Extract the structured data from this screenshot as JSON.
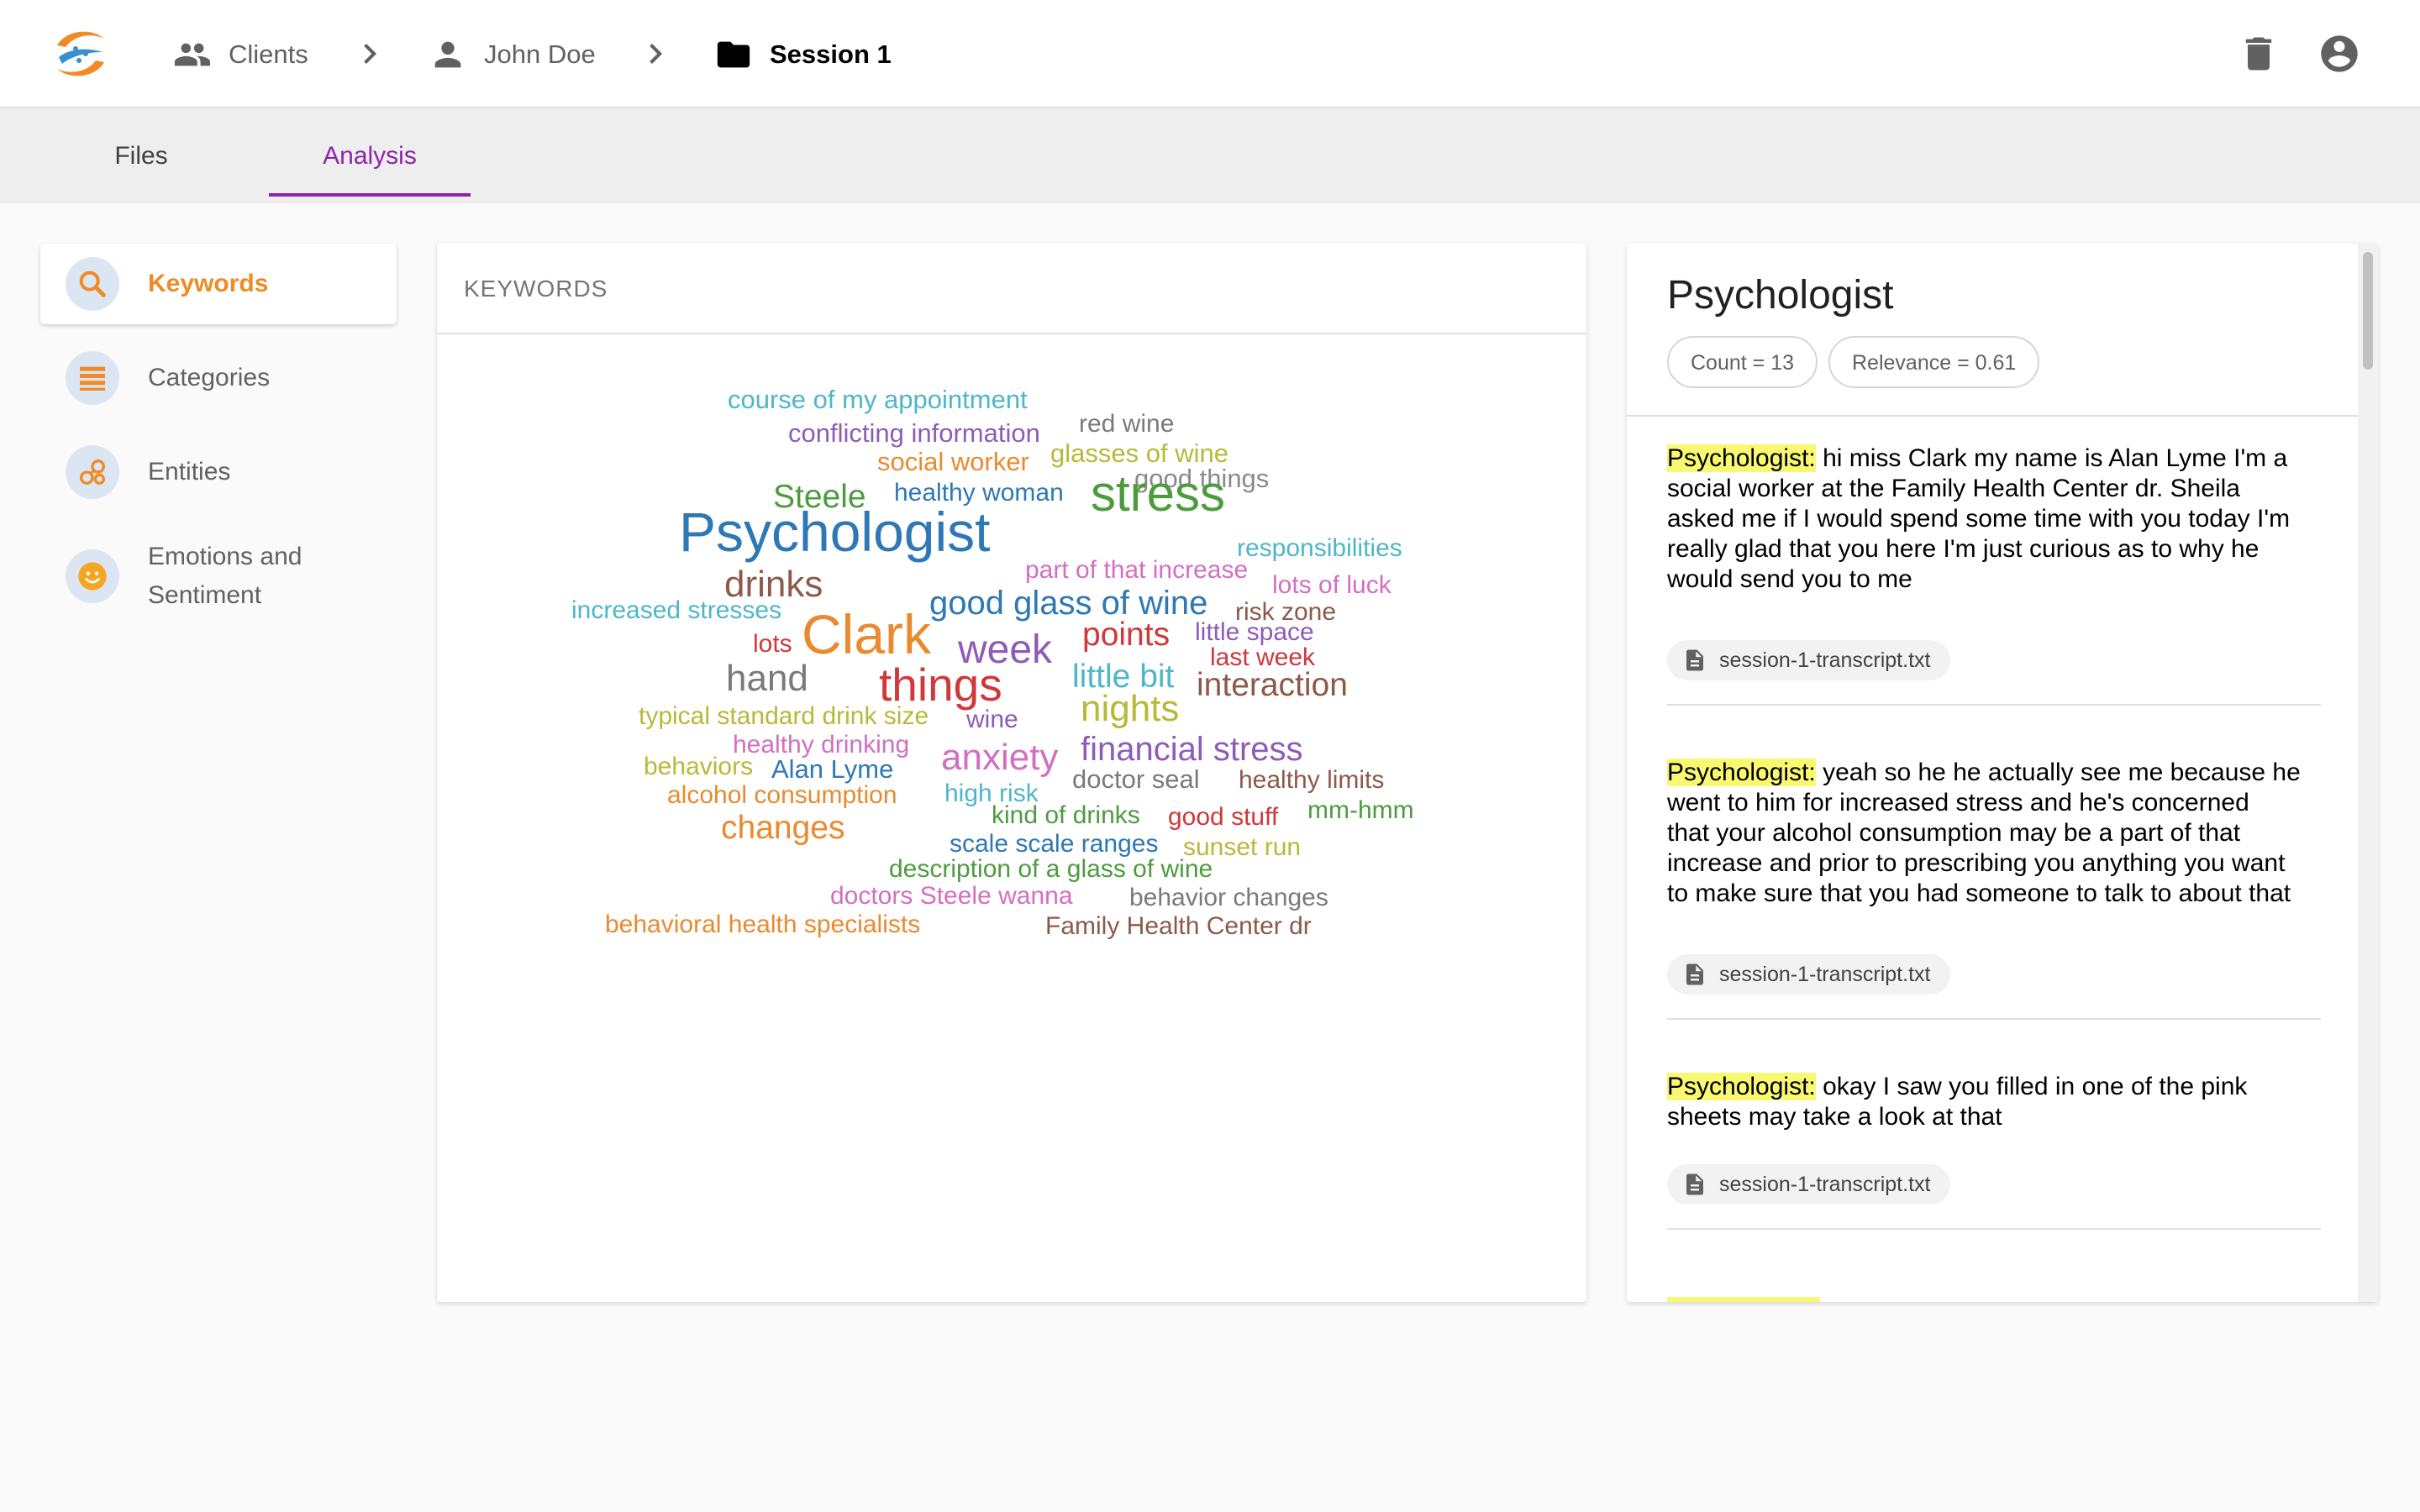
{
  "header": {
    "logo_icon": "app-logo-icon",
    "breadcrumbs": [
      {
        "label": "Clients",
        "icon": "people-icon"
      },
      {
        "label": "John Doe",
        "icon": "person-icon"
      },
      {
        "label": "Session 1",
        "icon": "folder-icon"
      }
    ],
    "actions": [
      "delete-icon",
      "account-icon"
    ]
  },
  "tabs": [
    {
      "label": "Files",
      "active": false
    },
    {
      "label": "Analysis",
      "active": true
    }
  ],
  "sidebar": {
    "items": [
      {
        "label": "Keywords",
        "icon": "search-icon",
        "active": true
      },
      {
        "label": "Categories",
        "icon": "list-icon",
        "active": false
      },
      {
        "label": "Entities",
        "icon": "entities-icon",
        "active": false
      },
      {
        "label": "Emotions and Sentiment",
        "icon": "smiley-icon",
        "active": false
      }
    ]
  },
  "keywords_panel": {
    "title": "KEYWORDS",
    "words": [
      {
        "text": "course of my appointment",
        "color": "#4fb6c8"
      },
      {
        "text": "conflicting information",
        "color": "#8e5bb5"
      },
      {
        "text": "red wine",
        "color": "#7a7a7a"
      },
      {
        "text": "social worker",
        "color": "#e98a2e"
      },
      {
        "text": "glasses of wine",
        "color": "#b8b839"
      },
      {
        "text": "good things",
        "color": "#8a8a8a"
      },
      {
        "text": "Steele",
        "color": "#4c9c3e"
      },
      {
        "text": "healthy woman",
        "color": "#2e78b5"
      },
      {
        "text": "stress",
        "color": "#4c9c3e"
      },
      {
        "text": "Psychologist",
        "color": "#2e78b5"
      },
      {
        "text": "responsibilities",
        "color": "#4fb6c8"
      },
      {
        "text": "part of that increase",
        "color": "#d36fc0"
      },
      {
        "text": "drinks",
        "color": "#8c5a4a"
      },
      {
        "text": "lots of luck",
        "color": "#d36fc0"
      },
      {
        "text": "good glass of wine",
        "color": "#2e78b5"
      },
      {
        "text": "increased stresses",
        "color": "#4fb6c8"
      },
      {
        "text": "risk zone",
        "color": "#8c5a4a"
      },
      {
        "text": "Clark",
        "color": "#e98a2e"
      },
      {
        "text": "lots",
        "color": "#d0383a"
      },
      {
        "text": "points",
        "color": "#d0383a"
      },
      {
        "text": "little space",
        "color": "#8e5bb5"
      },
      {
        "text": "week",
        "color": "#8e5bb5"
      },
      {
        "text": "last week",
        "color": "#d0383a"
      },
      {
        "text": "hand",
        "color": "#7a7a7a"
      },
      {
        "text": "things",
        "color": "#d0383a"
      },
      {
        "text": "little bit",
        "color": "#4fb6c8"
      },
      {
        "text": "interaction",
        "color": "#8c5a4a"
      },
      {
        "text": "typical standard drink size",
        "color": "#b8b839"
      },
      {
        "text": "wine",
        "color": "#8e5bb5"
      },
      {
        "text": "nights",
        "color": "#b8b839"
      },
      {
        "text": "healthy drinking",
        "color": "#d36fc0"
      },
      {
        "text": "anxiety",
        "color": "#d36fc0"
      },
      {
        "text": "financial stress",
        "color": "#8e5bb5"
      },
      {
        "text": "behaviors",
        "color": "#b8b839"
      },
      {
        "text": "Alan Lyme",
        "color": "#2e78b5"
      },
      {
        "text": "doctor seal",
        "color": "#7a7a7a"
      },
      {
        "text": "healthy limits",
        "color": "#8c5a4a"
      },
      {
        "text": "high risk",
        "color": "#4fb6c8"
      },
      {
        "text": "alcohol consumption",
        "color": "#e98a2e"
      },
      {
        "text": "mm-hmm",
        "color": "#4c9c3e"
      },
      {
        "text": "kind of drinks",
        "color": "#4c9c3e"
      },
      {
        "text": "good stuff",
        "color": "#d0383a"
      },
      {
        "text": "changes",
        "color": "#e98a2e"
      },
      {
        "text": "scale scale ranges",
        "color": "#2e78b5"
      },
      {
        "text": "sunset run",
        "color": "#b8b839"
      },
      {
        "text": "description of a glass of wine",
        "color": "#4c9c3e"
      },
      {
        "text": "doctors Steele wanna",
        "color": "#d36fc0"
      },
      {
        "text": "behavior changes",
        "color": "#7a7a7a"
      },
      {
        "text": "behavioral health specialists",
        "color": "#e98a2e"
      },
      {
        "text": "Family Health Center dr",
        "color": "#8c5a4a"
      }
    ]
  },
  "detail": {
    "title": "Psychologist",
    "count_label": "Count = 13",
    "relevance_label": "Relevance = 0.61",
    "entries": [
      {
        "speaker": "Psychologist:",
        "lines": [
          "hi miss Clark my name is Alan Lyme I'm a",
          "social worker at the Family Health Center dr. Sheila",
          "asked me if I would spend some time with you today I'm",
          "really glad that you here I'm just curious as to why he",
          "would send you to me"
        ],
        "file": "session-1-transcript.txt"
      },
      {
        "speaker": "Psychologist:",
        "lines": [
          "yeah so he he actually see me because he",
          "went to him for increased stress and he's concerned",
          "that your alcohol consumption may be a part of that",
          "increase and prior to prescribing you anything you want",
          "to make sure that you had someone to talk to about that"
        ],
        "file": "session-1-transcript.txt"
      },
      {
        "speaker": "Psychologist:",
        "lines": [
          "okay I saw you filled in one of the pink",
          "sheets may take a look at that"
        ],
        "file": "session-1-transcript.txt"
      }
    ]
  },
  "colors": {
    "accent_purple": "#8e24aa",
    "accent_orange": "#f08a24",
    "highlight": "#f9f871"
  }
}
